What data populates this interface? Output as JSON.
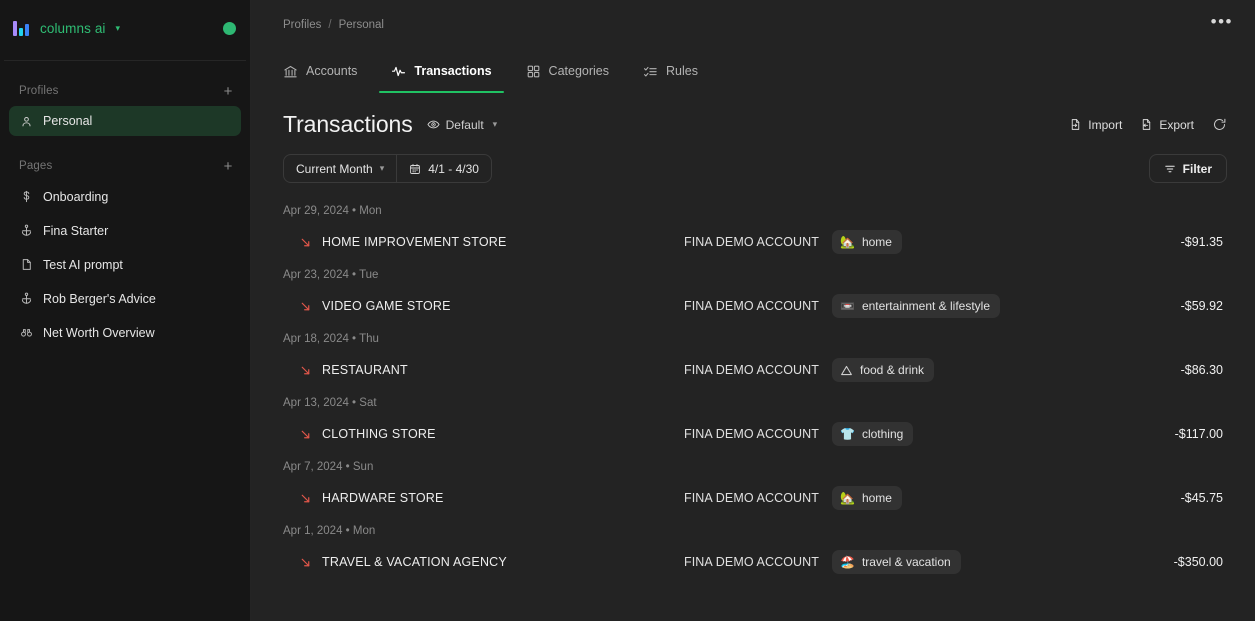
{
  "brand": {
    "name": "columns ai",
    "logo_icon": "bar-chart-logo",
    "chevron_icon": "chevron-down-icon",
    "status_dot_color": "#2eb873",
    "accent_color": "#2fbd74"
  },
  "sidebar": {
    "profiles": {
      "title": "Profiles",
      "add_label": "+",
      "items": [
        {
          "label": "Personal",
          "icon": "user-icon",
          "active": true
        }
      ]
    },
    "pages": {
      "title": "Pages",
      "add_label": "+",
      "items": [
        {
          "label": "Onboarding",
          "icon": "dollar-icon"
        },
        {
          "label": "Fina Starter",
          "icon": "anchor-icon"
        },
        {
          "label": "Test AI prompt",
          "icon": "file-icon"
        },
        {
          "label": "Rob Berger's Advice",
          "icon": "anchor-icon"
        },
        {
          "label": "Net Worth Overview",
          "icon": "binoculars-icon"
        }
      ]
    }
  },
  "header": {
    "breadcrumb": {
      "root": "Profiles",
      "separator": "/",
      "current": "Personal"
    },
    "more_label": "•••",
    "more_icon": "ellipsis-icon"
  },
  "tabs": [
    {
      "label": "Accounts",
      "icon": "bank-icon",
      "active": false
    },
    {
      "label": "Transactions",
      "icon": "activity-icon",
      "active": true
    },
    {
      "label": "Categories",
      "icon": "grid-icon",
      "active": false
    },
    {
      "label": "Rules",
      "icon": "checklist-icon",
      "active": false
    }
  ],
  "page": {
    "title": "Transactions",
    "view": {
      "label": "Default",
      "icon": "eye-icon",
      "chevron": "chevron-down-icon"
    },
    "toolbar": {
      "import_label": "Import",
      "import_icon": "import-file-icon",
      "export_label": "Export",
      "export_icon": "export-file-icon",
      "refresh_icon": "refresh-icon"
    },
    "filters": {
      "period_label": "Current Month",
      "period_chevron": "chevron-down-icon",
      "date_range_label": "4/1 - 4/30",
      "calendar_icon": "calendar-icon",
      "filter_label": "Filter",
      "filter_icon": "filter-icon"
    }
  },
  "transactions": {
    "direction_icon": "arrow-down-right-icon",
    "direction_color": "#e0564a",
    "groups": [
      {
        "date_label": "Apr 29, 2024 • Mon",
        "rows": [
          {
            "name": "HOME IMPROVEMENT STORE",
            "account": "FINA DEMO ACCOUNT",
            "category": "home",
            "category_emoji": "🏡",
            "category_icon": "house-emoji",
            "amount": "-$91.35"
          }
        ]
      },
      {
        "date_label": "Apr 23, 2024 • Tue",
        "rows": [
          {
            "name": "VIDEO GAME STORE",
            "account": "FINA DEMO ACCOUNT",
            "category": "entertainment & lifestyle",
            "category_emoji": "📼",
            "category_icon": "film-frames-emoji",
            "amount": "-$59.92"
          }
        ]
      },
      {
        "date_label": "Apr 18, 2024 • Thu",
        "rows": [
          {
            "name": "RESTAURANT",
            "account": "FINA DEMO ACCOUNT",
            "category": "food & drink",
            "category_emoji": "",
            "category_icon": "triangle-outline-icon",
            "amount": "-$86.30"
          }
        ]
      },
      {
        "date_label": "Apr 13, 2024 • Sat",
        "rows": [
          {
            "name": "CLOTHING STORE",
            "account": "FINA DEMO ACCOUNT",
            "category": "clothing",
            "category_emoji": "👕",
            "category_icon": "tshirt-emoji",
            "amount": "-$117.00"
          }
        ]
      },
      {
        "date_label": "Apr 7, 2024 • Sun",
        "rows": [
          {
            "name": "HARDWARE STORE",
            "account": "FINA DEMO ACCOUNT",
            "category": "home",
            "category_emoji": "🏡",
            "category_icon": "house-emoji",
            "amount": "-$45.75"
          }
        ]
      },
      {
        "date_label": "Apr 1, 2024 • Mon",
        "rows": [
          {
            "name": "TRAVEL & VACATION AGENCY",
            "account": "FINA DEMO ACCOUNT",
            "category": "travel & vacation",
            "category_emoji": "🏖️",
            "category_icon": "beach-umbrella-emoji",
            "amount": "-$350.00"
          }
        ]
      }
    ]
  }
}
